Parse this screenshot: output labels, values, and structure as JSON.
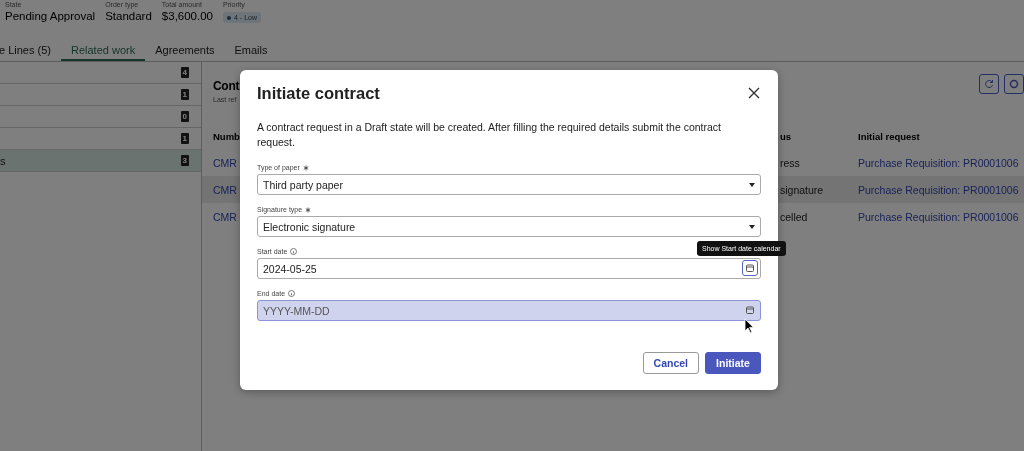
{
  "header_fields": [
    {
      "label": "State",
      "value": "Pending Approval"
    },
    {
      "label": "Order type",
      "value": "Standard"
    },
    {
      "label": "Total amount",
      "value": "$3,600.00"
    },
    {
      "label": "Priority",
      "value": "4 - Low",
      "kind": "badge"
    }
  ],
  "tabs": [
    {
      "label": "e Lines (5)",
      "selected": false
    },
    {
      "label": "Related work",
      "selected": true
    },
    {
      "label": "Agreements",
      "selected": false
    },
    {
      "label": "Emails",
      "selected": false
    }
  ],
  "sidebar": {
    "items": [
      {
        "count": "4",
        "selected": false
      },
      {
        "count": "1",
        "selected": false
      },
      {
        "count": "0",
        "selected": false
      },
      {
        "count": "1",
        "selected": false
      },
      {
        "label": "s",
        "count": "3",
        "selected": true
      }
    ]
  },
  "panel": {
    "title": "Cont",
    "subtitle": "Last ref",
    "table": {
      "columns": [
        "Numb",
        "us",
        "Initial request"
      ],
      "rows": [
        {
          "number": "CMR",
          "status": "ress",
          "initial_request": "Purchase Requisition: PR0001006",
          "hovered": false
        },
        {
          "number": "CMR",
          "status": "signature",
          "initial_request": "Purchase Requisition: PR0001006",
          "hovered": true
        },
        {
          "number": "CMR",
          "status": "celled",
          "initial_request": "Purchase Requisition: PR0001006",
          "hovered": false
        }
      ]
    }
  },
  "dialog": {
    "title": "Initiate contract",
    "description": "A contract request in a Draft state will be created. After filling the required details submit the contract request.",
    "fields": [
      {
        "kind": "select",
        "label": "Type of paper",
        "required": true,
        "value": "Third party paper"
      },
      {
        "kind": "select",
        "label": "Signature type",
        "required": true,
        "value": "Electronic signature"
      },
      {
        "kind": "date",
        "label": "Start date",
        "value": "2024-05-25",
        "hovered": false,
        "button_focused": true
      },
      {
        "kind": "date",
        "label": "End date",
        "placeholder": "YYYY-MM-DD",
        "hovered": true,
        "button_focused": false
      }
    ],
    "buttons": [
      {
        "label": "Cancel",
        "kind": "secondary"
      },
      {
        "label": "Initiate",
        "kind": "primary"
      }
    ],
    "tooltip": "Show Start date calendar"
  }
}
